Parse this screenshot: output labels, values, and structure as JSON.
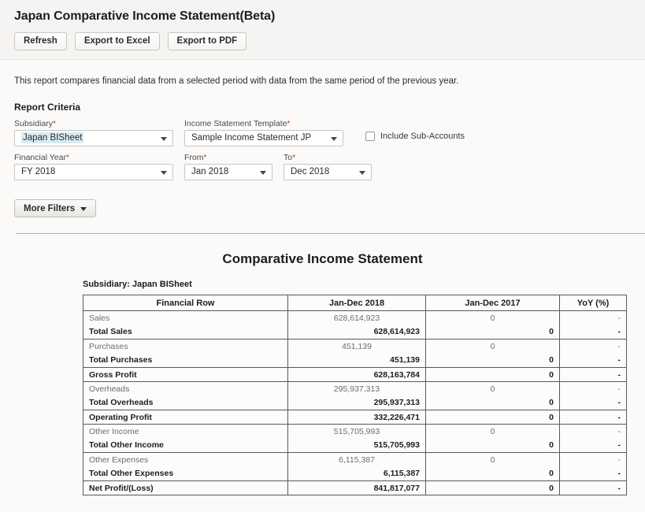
{
  "toolbar": {
    "title": "Japan Comparative Income Statement(Beta)",
    "buttons": [
      {
        "label": "Refresh",
        "name": "refresh-button"
      },
      {
        "label": "Export to Excel",
        "name": "export-excel-button"
      },
      {
        "label": "Export to PDF",
        "name": "export-pdf-button"
      }
    ]
  },
  "description": "This report compares financial data from a selected period with data from the same period of the previous year.",
  "criteria": {
    "heading": "Report Criteria",
    "fields": {
      "subsidiary": {
        "label": "Subsidiary",
        "required": "*",
        "value": "Japan BISheet"
      },
      "template": {
        "label": "Income Statement Template",
        "required": "*",
        "value": "Sample Income Statement JP"
      },
      "financial_year": {
        "label": "Financial Year",
        "required": "*",
        "value": "FY 2018"
      },
      "from": {
        "label": "From",
        "required": "*",
        "value": "Jan 2018"
      },
      "to": {
        "label": "To",
        "required": "*",
        "value": "Dec 2018"
      }
    },
    "include_sub_accounts": {
      "label": "Include Sub-Accounts",
      "checked": false
    },
    "more_filters_label": "More Filters"
  },
  "report": {
    "title": "Comparative Income Statement",
    "subsidiary_line": "Subsidiary: Japan BISheet",
    "columns": [
      "Financial Row",
      "Jan-Dec 2018",
      "Jan-Dec 2017",
      "YoY (%)"
    ],
    "rows": [
      {
        "type": "detail",
        "label": "Sales",
        "current": "628,614,923",
        "previous": "0",
        "yoy": "-"
      },
      {
        "type": "total",
        "label": "Total Sales",
        "current": "628,614,923",
        "previous": "0",
        "yoy": "-"
      },
      {
        "type": "detail",
        "label": "Purchases",
        "current": "451,139",
        "previous": "0",
        "yoy": "-"
      },
      {
        "type": "total",
        "label": "Total Purchases",
        "current": "451,139",
        "previous": "0",
        "yoy": "-"
      },
      {
        "type": "subtotal",
        "label": "Gross Profit",
        "current": "628,163,784",
        "previous": "0",
        "yoy": "-"
      },
      {
        "type": "detail",
        "label": "Overheads",
        "current": "295,937,313",
        "previous": "0",
        "yoy": "-"
      },
      {
        "type": "total",
        "label": "Total Overheads",
        "current": "295,937,313",
        "previous": "0",
        "yoy": "-"
      },
      {
        "type": "subtotal",
        "label": "Operating Profit",
        "current": "332,226,471",
        "previous": "0",
        "yoy": "-"
      },
      {
        "type": "detail",
        "label": "Other Income",
        "current": "515,705,993",
        "previous": "0",
        "yoy": "-"
      },
      {
        "type": "total",
        "label": "Total Other Income",
        "current": "515,705,993",
        "previous": "0",
        "yoy": "-"
      },
      {
        "type": "detail",
        "label": "Other Expenses",
        "current": "6,115,387",
        "previous": "0",
        "yoy": "-"
      },
      {
        "type": "total",
        "label": "Total Other Expenses",
        "current": "6,115,387",
        "previous": "0",
        "yoy": "-"
      },
      {
        "type": "subtotal",
        "label": "Net Profit/(Loss)",
        "current": "841,817,077",
        "previous": "0",
        "yoy": "-"
      }
    ]
  },
  "colors": {
    "toolbar_bg": "#f5f4f2",
    "page_bg": "#fbfaf8",
    "required_marker": "#c23934",
    "highlight": "#d9eaf4",
    "table_border": "#595959",
    "detail_text": "#6d6d6d"
  }
}
